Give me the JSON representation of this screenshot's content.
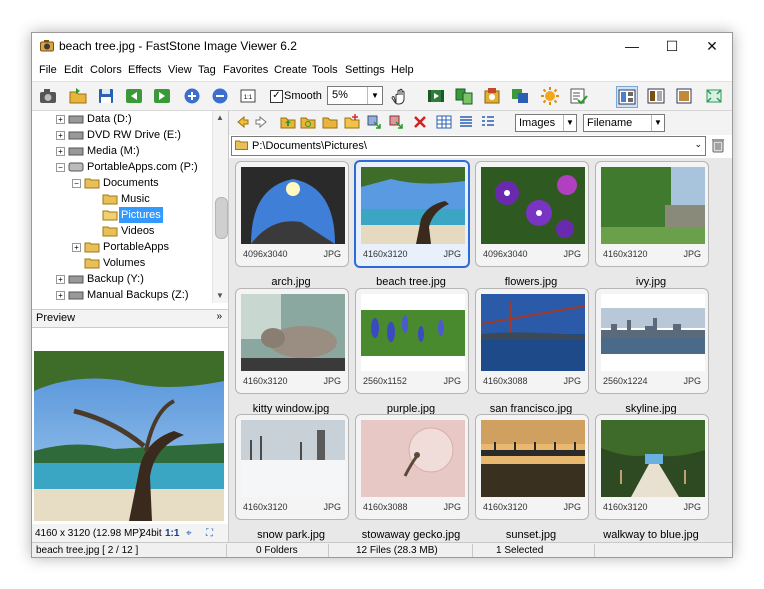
{
  "window": {
    "title": "beach tree.jpg  -  FastStone Image Viewer 6.2"
  },
  "title_buttons": {
    "minimize": "—",
    "maximize": "☐",
    "close": "✕"
  },
  "menu": [
    "File",
    "Edit",
    "Colors",
    "Effects",
    "View",
    "Tag",
    "Favorites",
    "Create",
    "Tools",
    "Settings",
    "Help"
  ],
  "toolbar": {
    "smooth_checked": "✓",
    "smooth_label": "Smooth",
    "zoom_value": "5%"
  },
  "tree": [
    {
      "label": "Data (D:)"
    },
    {
      "label": "DVD RW Drive (E:)"
    },
    {
      "label": "Media (M:)"
    },
    {
      "label": "PortableApps.com (P:)"
    },
    {
      "label": "Documents"
    },
    {
      "label": "Music"
    },
    {
      "label": "Pictures"
    },
    {
      "label": "Videos"
    },
    {
      "label": "PortableApps"
    },
    {
      "label": "Volumes"
    },
    {
      "label": "Backup (Y:)"
    },
    {
      "label": "Manual Backups (Z:)"
    }
  ],
  "preview": {
    "title": "Preview",
    "info": "4160 x 3120 (12.98 MP)",
    "bits": "24bit",
    "ratio": "1:1"
  },
  "nav": {
    "filter": "Images",
    "sort": "Filename",
    "path": "P:\\Documents\\Pictures\\"
  },
  "thumbnails": [
    {
      "name": "arch.jpg",
      "dims": "4096x3040",
      "ext": "JPG",
      "selected": false
    },
    {
      "name": "beach tree.jpg",
      "dims": "4160x3120",
      "ext": "JPG",
      "selected": true
    },
    {
      "name": "flowers.jpg",
      "dims": "4096x3040",
      "ext": "JPG",
      "selected": false
    },
    {
      "name": "ivy.jpg",
      "dims": "4160x3120",
      "ext": "JPG",
      "selected": false
    },
    {
      "name": "kitty window.jpg",
      "dims": "4160x3120",
      "ext": "JPG",
      "selected": false
    },
    {
      "name": "purple.jpg",
      "dims": "2560x1152",
      "ext": "JPG",
      "selected": false
    },
    {
      "name": "san francisco.jpg",
      "dims": "4160x3088",
      "ext": "JPG",
      "selected": false
    },
    {
      "name": "skyline.jpg",
      "dims": "2560x1224",
      "ext": "JPG",
      "selected": false
    },
    {
      "name": "snow park.jpg",
      "dims": "4160x3120",
      "ext": "JPG",
      "selected": false
    },
    {
      "name": "stowaway gecko.jpg",
      "dims": "4160x3088",
      "ext": "JPG",
      "selected": false
    },
    {
      "name": "sunset.jpg",
      "dims": "4160x3120",
      "ext": "JPG",
      "selected": false
    },
    {
      "name": "walkway to blue.jpg",
      "dims": "4160x3120",
      "ext": "JPG",
      "selected": false
    }
  ],
  "status": {
    "file": "beach tree.jpg [ 2 / 12 ]",
    "folders": "0 Folders",
    "files": "12 Files (28.3 MB)",
    "selected": "1 Selected"
  }
}
